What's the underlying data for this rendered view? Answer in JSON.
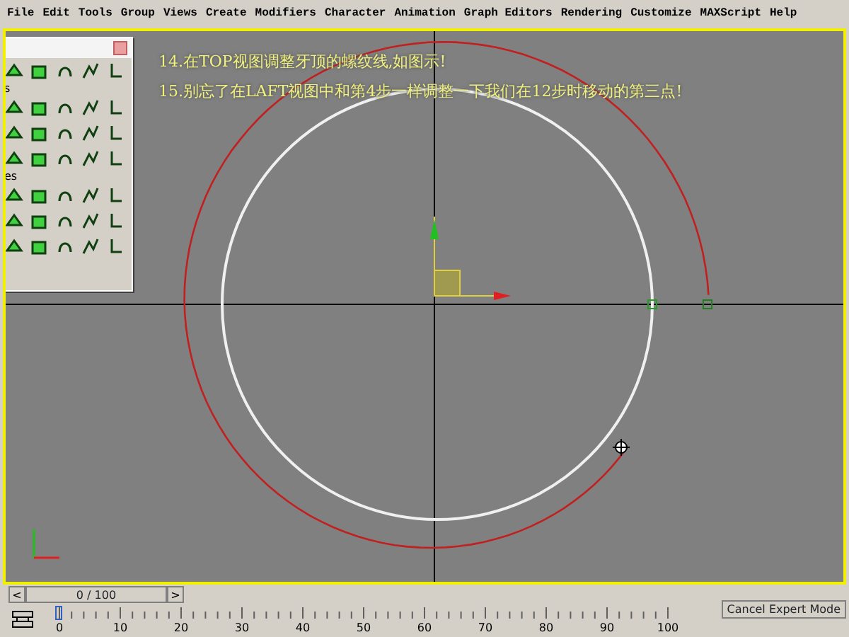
{
  "menu": [
    "File",
    "Edit",
    "Tools",
    "Group",
    "Views",
    "Create",
    "Modifiers",
    "Character",
    "Animation",
    "Graph Editors",
    "Rendering",
    "Customize",
    "MAXScript",
    "Help"
  ],
  "instructions": [
    "14.在TOP视图调整牙顶的螺纹线,如图示!",
    "15.别忘了在LAFT视图中和第4步一样调整一下我们在12步时移动的第三点!"
  ],
  "panel": {
    "labels": [
      "s",
      "es"
    ]
  },
  "time_slider": {
    "prev": "<",
    "frame": "0 / 100",
    "next": ">"
  },
  "track_bar": {
    "ticks": [
      "0",
      "10",
      "20",
      "30",
      "40",
      "50",
      "60",
      "70",
      "80",
      "90",
      "100"
    ]
  },
  "status_button": "Cancel Expert Mode"
}
